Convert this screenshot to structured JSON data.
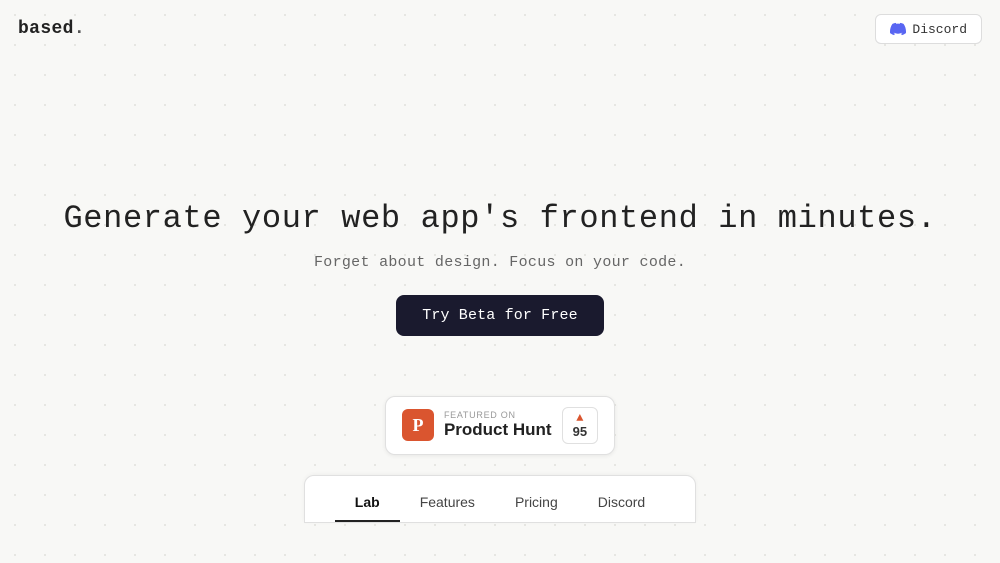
{
  "nav": {
    "logo": "based",
    "logo_dot": ".",
    "discord_button_label": "Discord"
  },
  "hero": {
    "title": "Generate your web app's frontend in minutes.",
    "subtitle": "Forget about design. Focus on your code.",
    "cta_label": "Try Beta for Free"
  },
  "product_hunt": {
    "featured_on": "FEATURED ON",
    "name": "Product Hunt",
    "upvote_count": "95",
    "logo_letter": "P"
  },
  "bottom_nav": {
    "items": [
      {
        "label": "Lab",
        "active": true
      },
      {
        "label": "Features",
        "active": false
      },
      {
        "label": "Pricing",
        "active": false
      },
      {
        "label": "Discord",
        "active": false
      }
    ]
  },
  "icons": {
    "discord": "discord-icon",
    "upvote_arrow": "▲"
  }
}
